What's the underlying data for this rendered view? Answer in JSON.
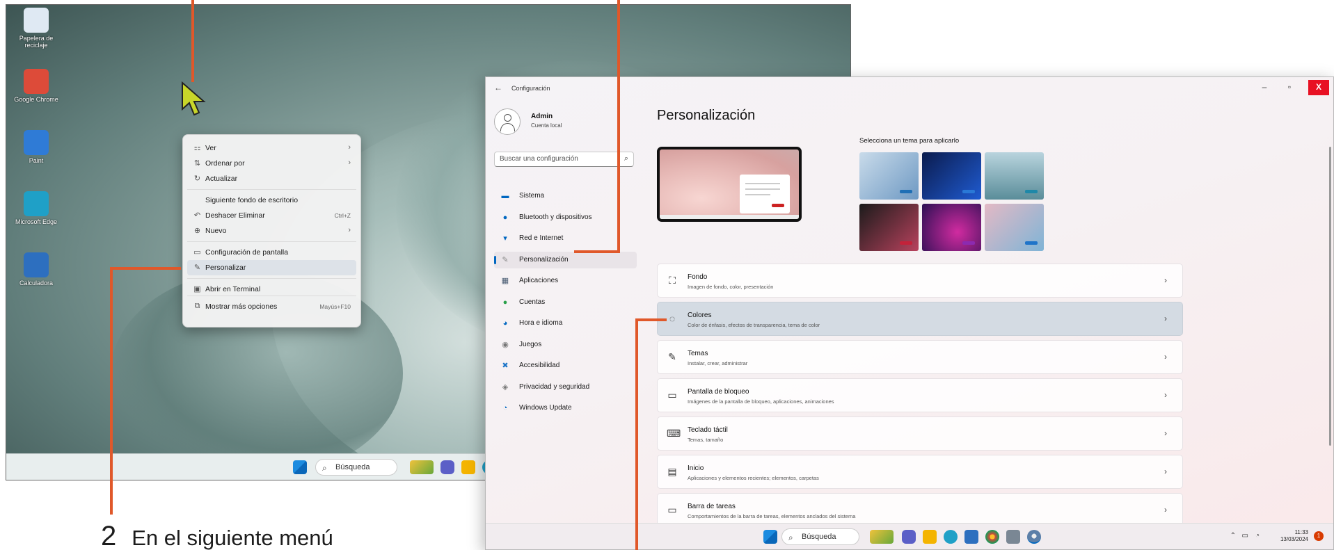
{
  "desktop": {
    "icons": [
      {
        "label": "Papelera de reciclaje",
        "icon": "recycle-bin-icon",
        "color": "#dfe9f3"
      },
      {
        "label": "Google Chrome",
        "icon": "chrome-icon",
        "color": "#dd4b39"
      },
      {
        "label": "Paint",
        "icon": "paint-icon",
        "color": "#2f7bd6"
      },
      {
        "label": "Microsoft Edge",
        "icon": "edge-icon",
        "color": "#1fa0c7"
      },
      {
        "label": "Calculadora",
        "icon": "calculator-icon",
        "color": "#2d6fbf"
      }
    ],
    "taskbar": {
      "search_label": "Búsqueda"
    },
    "context_menu": {
      "items": [
        {
          "label": "Ver",
          "icon": "grid-icon",
          "glyph": "⚏",
          "submenu": true
        },
        {
          "label": "Ordenar por",
          "icon": "sort-icon",
          "glyph": "⇅",
          "submenu": true
        },
        {
          "label": "Actualizar",
          "icon": "refresh-icon",
          "glyph": "↻"
        },
        {
          "label": "Siguiente fondo de escritorio",
          "icon": "",
          "glyph": ""
        },
        {
          "label": "Deshacer Eliminar",
          "icon": "undo-icon",
          "glyph": "↶",
          "shortcut": "Ctrl+Z"
        },
        {
          "label": "Nuevo",
          "icon": "new-icon",
          "glyph": "⊕",
          "submenu": true
        },
        {
          "label": "Configuración de pantalla",
          "icon": "display-icon",
          "glyph": "▭"
        },
        {
          "label": "Personalizar",
          "icon": "brush-icon",
          "glyph": "✎"
        },
        {
          "label": "Abrir en Terminal",
          "icon": "terminal-icon",
          "glyph": "▣"
        },
        {
          "label": "Mostrar más opciones",
          "icon": "more-options-icon",
          "glyph": "⧉",
          "shortcut": "Mayús+F10"
        }
      ]
    }
  },
  "settings": {
    "window_title": "Configuración",
    "controls": {
      "minimize": "–",
      "maximize": "▫",
      "close": "X"
    },
    "user": {
      "name": "Admin",
      "subtitle": "Cuenta local"
    },
    "search_placeholder": "Buscar una configuración",
    "nav": [
      {
        "label": "Sistema",
        "icon": "system-icon",
        "glyph": "▬",
        "color": "#0067c0"
      },
      {
        "label": "Bluetooth y dispositivos",
        "icon": "bluetooth-icon",
        "glyph": "●",
        "color": "#0067c0"
      },
      {
        "label": "Red e Internet",
        "icon": "wifi-icon",
        "glyph": "▾",
        "color": "#0067c0"
      },
      {
        "label": "Personalización",
        "icon": "brush-icon",
        "glyph": "✎",
        "color": "#8a8a8a",
        "selected": true
      },
      {
        "label": "Aplicaciones",
        "icon": "apps-icon",
        "glyph": "▦",
        "color": "#4a5d73"
      },
      {
        "label": "Cuentas",
        "icon": "accounts-icon",
        "glyph": "●",
        "color": "#2aa04a"
      },
      {
        "label": "Hora e idioma",
        "icon": "time-language-icon",
        "glyph": "◕",
        "color": "#0067c0"
      },
      {
        "label": "Juegos",
        "icon": "games-icon",
        "glyph": "◉",
        "color": "#777"
      },
      {
        "label": "Accesibilidad",
        "icon": "accessibility-icon",
        "glyph": "✖",
        "color": "#1a73c7"
      },
      {
        "label": "Privacidad y seguridad",
        "icon": "shield-icon",
        "glyph": "◈",
        "color": "#777"
      },
      {
        "label": "Windows Update",
        "icon": "update-icon",
        "glyph": "◔",
        "color": "#0067c0"
      }
    ],
    "page_title": "Personalización",
    "themes_label": "Selecciona un tema para aplicarlo",
    "themes": [
      {
        "name": "theme-1",
        "bg": "linear-gradient(135deg,#c9dbea,#6e99c3)",
        "accent": "#1f6fb5"
      },
      {
        "name": "theme-2",
        "bg": "linear-gradient(135deg,#0b1b4d,#1f5bd1)",
        "accent": "#2a78d6"
      },
      {
        "name": "theme-3",
        "bg": "linear-gradient(180deg,#b9d4de,#5a8d9a)",
        "accent": "#1e88a8"
      },
      {
        "name": "theme-4",
        "bg": "linear-gradient(135deg,#1b1b1b,#b8425d)",
        "accent": "#c3223a"
      },
      {
        "name": "theme-5",
        "bg": "radial-gradient(circle at 60% 60%,#d12ba0,#2a0f53)",
        "accent": "#8c2ab0"
      },
      {
        "name": "theme-6",
        "bg": "linear-gradient(135deg,#e3b9c5,#7fb4d6)",
        "accent": "#1f74c9"
      }
    ],
    "cards": [
      {
        "title": "Fondo",
        "subtitle": "Imagen de fondo, color, presentación",
        "icon": "picture-icon",
        "glyph": "⛶"
      },
      {
        "title": "Colores",
        "subtitle": "Color de énfasis, efectos de transparencia, tema de color",
        "icon": "palette-icon",
        "glyph": "◌",
        "highlighted": true
      },
      {
        "title": "Temas",
        "subtitle": "Instalar, crear, administrar",
        "icon": "brush-icon",
        "glyph": "✎"
      },
      {
        "title": "Pantalla de bloqueo",
        "subtitle": "Imágenes de la pantalla de bloqueo, aplicaciones, animaciones",
        "icon": "lock-screen-icon",
        "glyph": "▭"
      },
      {
        "title": "Teclado táctil",
        "subtitle": "Temas, tamaño",
        "icon": "keyboard-icon",
        "glyph": "⌨"
      },
      {
        "title": "Inicio",
        "subtitle": "Aplicaciones y elementos recientes; elementos, carpetas",
        "icon": "start-icon",
        "glyph": "▤"
      },
      {
        "title": "Barra de tareas",
        "subtitle": "Comportamientos de la barra de tareas, elementos anclados del sistema",
        "icon": "taskbar-icon",
        "glyph": "▭"
      }
    ],
    "taskbar": {
      "search_label": "Búsqueda",
      "time": "11:33",
      "date": "13/03/2024",
      "notifications": "1"
    }
  },
  "caption": {
    "number": "2",
    "text": "En el siguiente menú"
  },
  "colors": {
    "annotation": "#e0582a",
    "accent": "#0067c0",
    "close": "#e81123",
    "cursor": "#c8d62a"
  }
}
